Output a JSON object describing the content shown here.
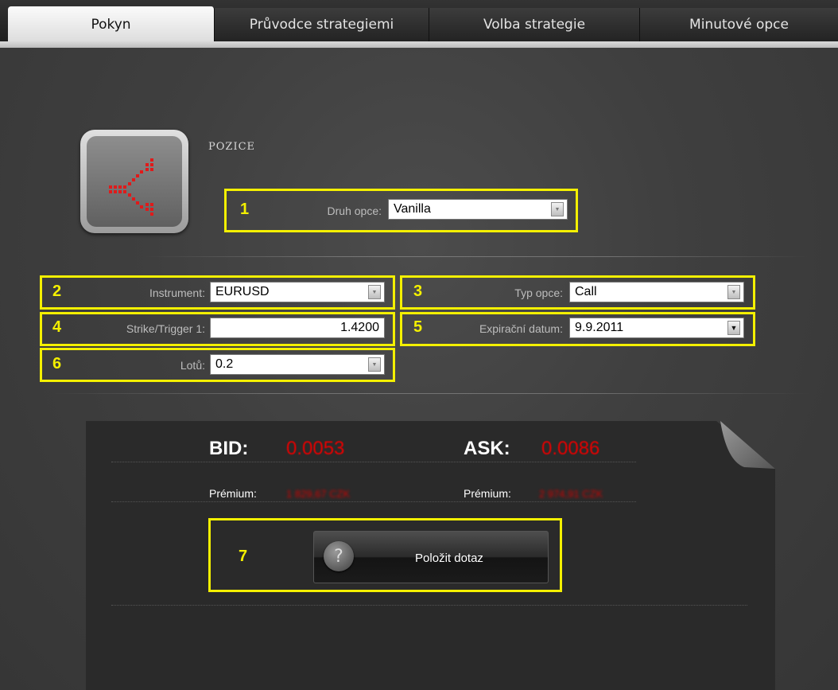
{
  "tabs": [
    {
      "label": "Pokyn"
    },
    {
      "label": "Průvodce strategiemi"
    },
    {
      "label": "Volba strategie"
    },
    {
      "label": "Minutové opce"
    }
  ],
  "section": {
    "title": "POZICE"
  },
  "annotations": [
    "1",
    "2",
    "3",
    "4",
    "5",
    "6",
    "7"
  ],
  "form": {
    "druh_opce": {
      "label": "Druh opce:",
      "value": "Vanilla"
    },
    "instrument": {
      "label": "Instrument:",
      "value": "EURUSD"
    },
    "typ_opce": {
      "label": "Typ opce:",
      "value": "Call"
    },
    "strike": {
      "label": "Strike/Trigger 1:",
      "value": "1.4200"
    },
    "expirace": {
      "label": "Expirační datum:",
      "value": "9.9.2011"
    },
    "lotu": {
      "label": "Lotů:",
      "value": "0.2"
    }
  },
  "quote": {
    "bid_label": "BID:",
    "bid_value": "0.0053",
    "ask_label": "ASK:",
    "ask_value": "0.0086",
    "premium_label": "Prémium:",
    "bid_premium": "1 829,67 CZK",
    "ask_premium": "2 974,91 CZK"
  },
  "ask_button": {
    "label": "Položit dotaz",
    "icon": "question-icon"
  },
  "colors": {
    "highlight": "#f4f000",
    "price": "#e50000",
    "panel": "#2a2a2a"
  }
}
